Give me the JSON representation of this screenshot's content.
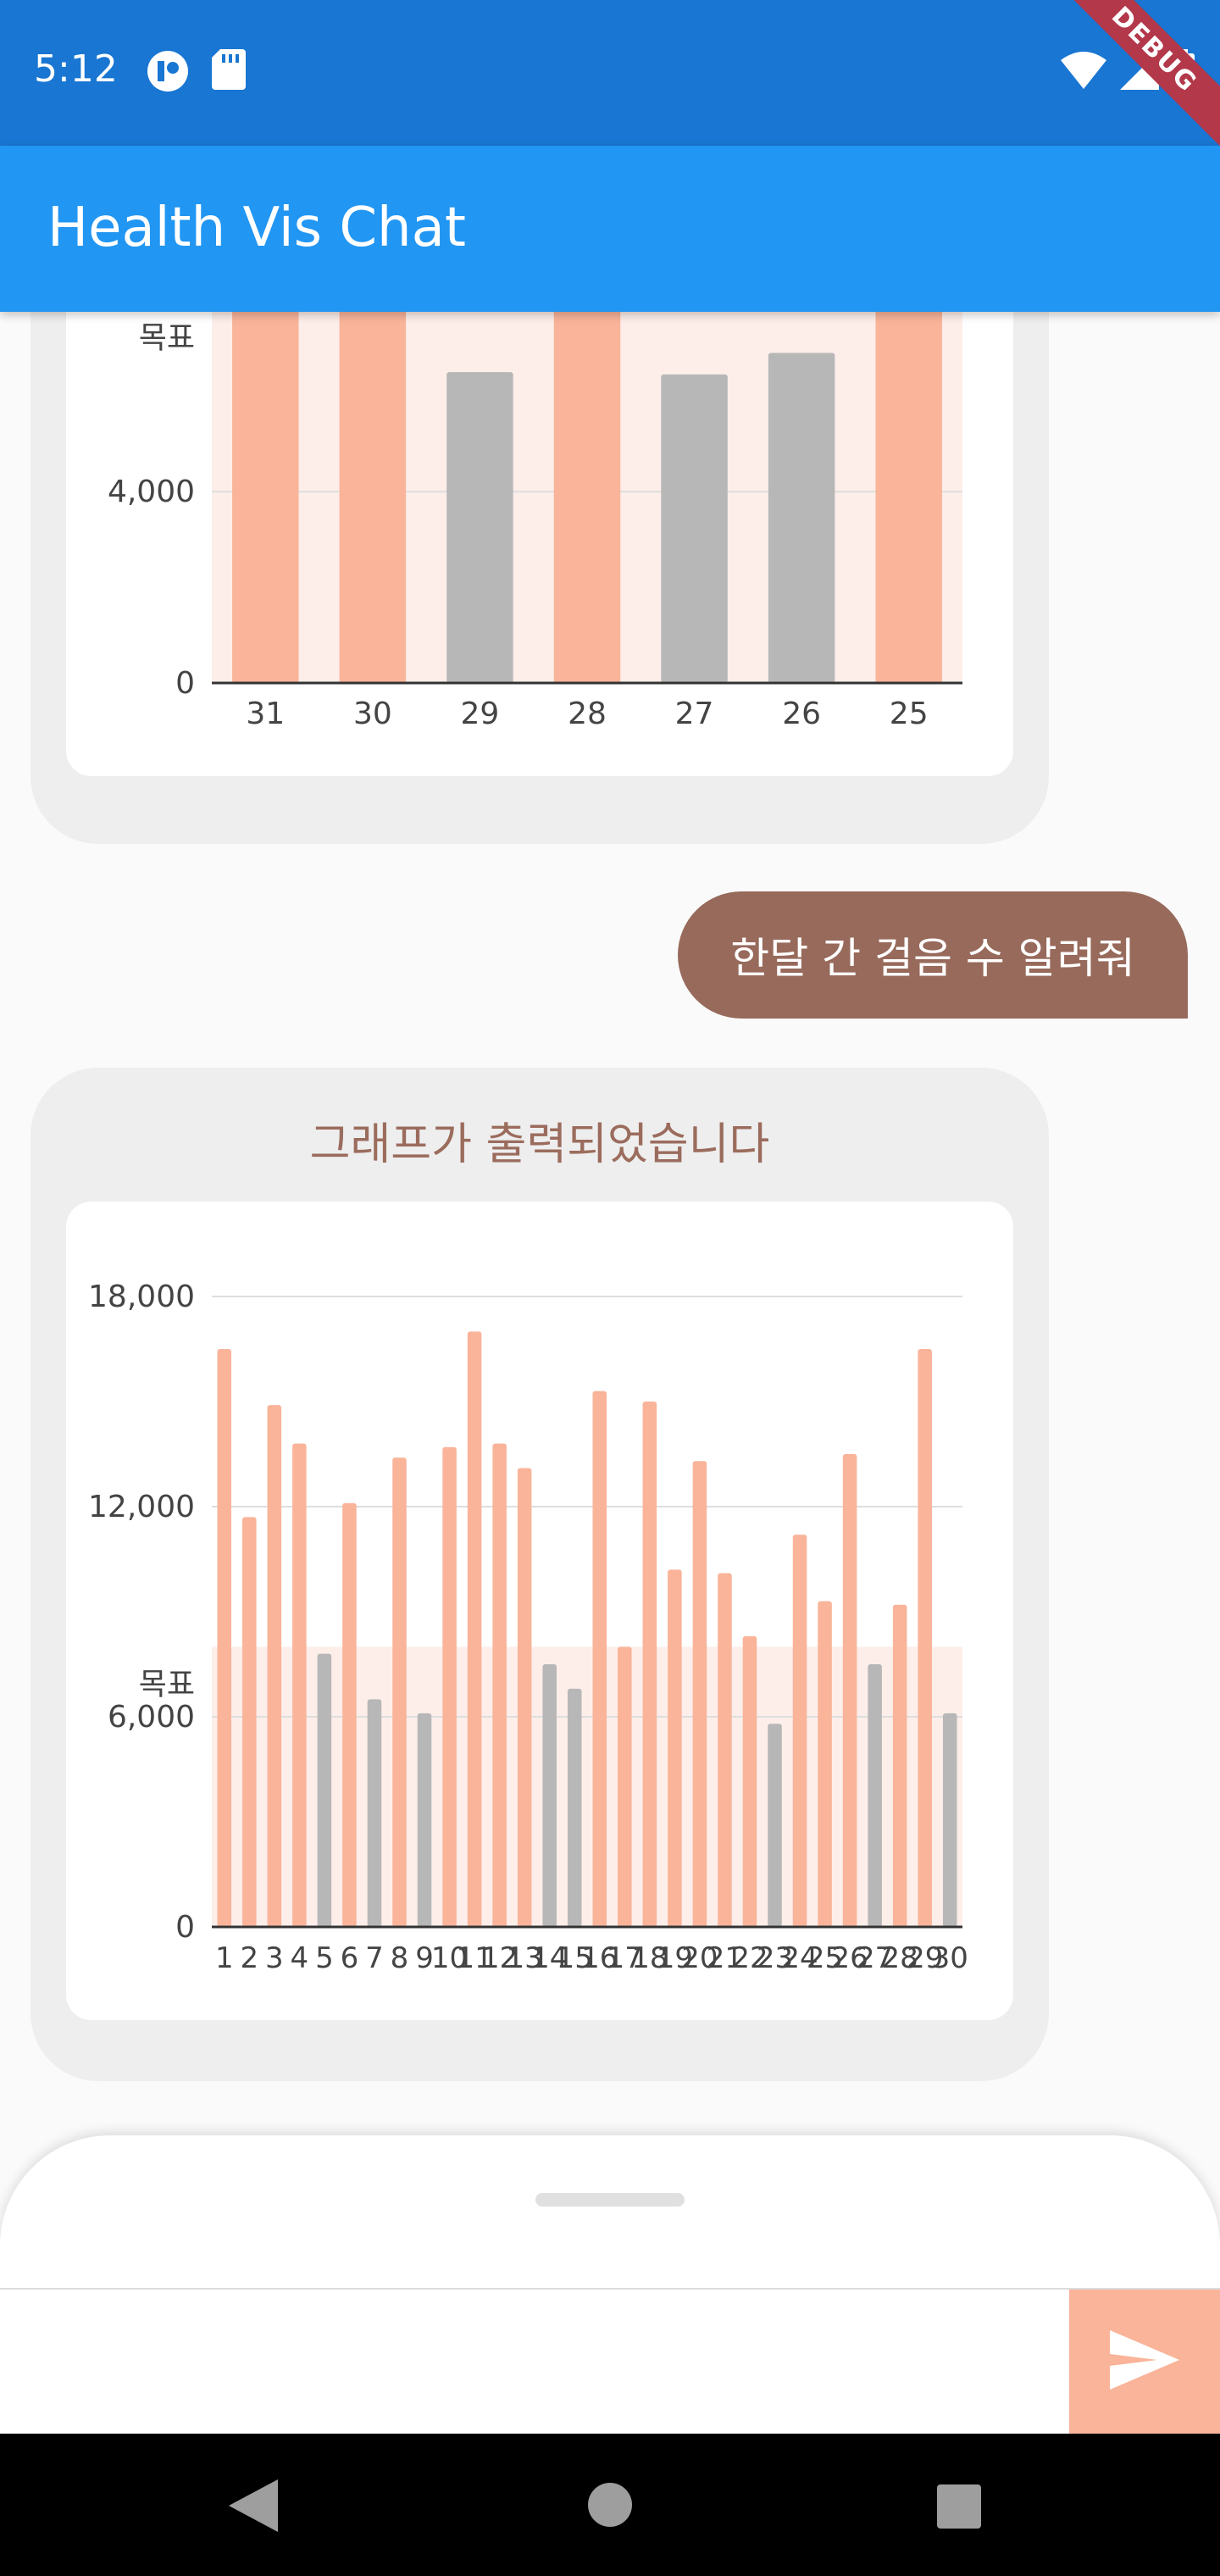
{
  "status_bar": {
    "time": "5:12",
    "debug_label": "DEBUG"
  },
  "app_bar": {
    "title": "Health Vis Chat"
  },
  "messages": {
    "user_message": "한달 간 걸음 수 알려줘",
    "bot_message_title": "그래프가 출력되었습니다"
  },
  "input": {
    "placeholder": ""
  },
  "colors": {
    "primary": "#2196f3",
    "status_bar": "#1976d2",
    "bar_goal_met": "#f9b49a",
    "bar_goal_missed": "#b7b7b7",
    "user_bubble": "#976a5b",
    "send_button": "#f9b49a"
  },
  "icons": [
    "signal-icon",
    "sd-card-icon",
    "wifi-icon",
    "cellular-icon",
    "battery-icon",
    "send-icon",
    "back-icon",
    "home-icon",
    "recents-icon"
  ],
  "chart_data": [
    {
      "type": "bar",
      "categories": [
        "31",
        "30",
        "29",
        "28",
        "27",
        "26",
        "25"
      ],
      "values": [
        9000,
        9000,
        6500,
        9000,
        6450,
        6900,
        9000
      ],
      "ylim": [
        0,
        9000
      ],
      "yticks": [
        "0",
        "4,000"
      ],
      "goal_label": "목표",
      "goal_value": 8000,
      "partial": true
    },
    {
      "type": "bar",
      "categories": [
        "1",
        "2",
        "3",
        "4",
        "5",
        "6",
        "7",
        "8",
        "9",
        "10",
        "11",
        "12",
        "13",
        "14",
        "15",
        "16",
        "17",
        "18",
        "19",
        "20",
        "21",
        "22",
        "23",
        "24",
        "25",
        "26",
        "27",
        "28",
        "29",
        "30"
      ],
      "values": [
        16500,
        11700,
        14900,
        13800,
        7800,
        12100,
        6500,
        13400,
        6100,
        13700,
        17000,
        13800,
        13100,
        7500,
        6800,
        15300,
        8000,
        15000,
        10200,
        13300,
        10100,
        8300,
        5800,
        11200,
        9300,
        13500,
        7500,
        9200,
        16500,
        6100
      ],
      "ylim": [
        0,
        18000
      ],
      "yticks": [
        "0",
        "6,000",
        "12,000",
        "18,000"
      ],
      "goal_label": "목표",
      "goal_value": 8000
    }
  ]
}
